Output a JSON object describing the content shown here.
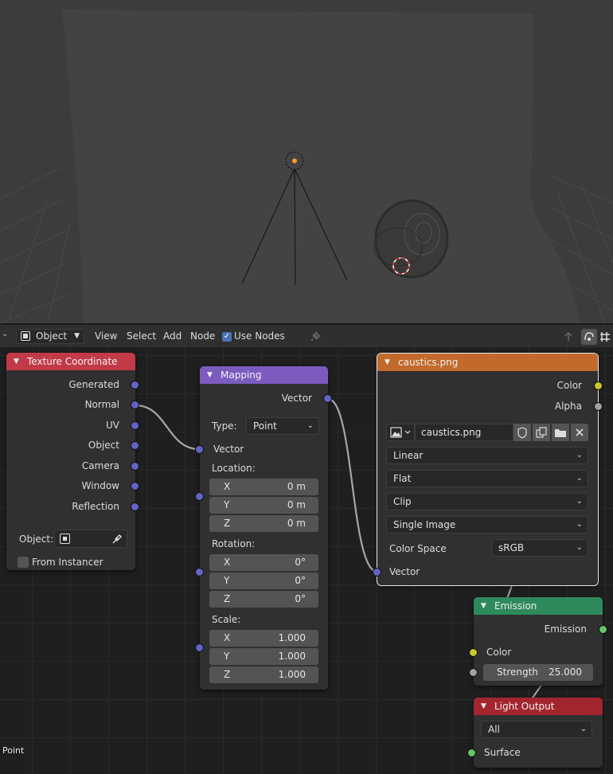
{
  "header": {
    "mode_label": "Object",
    "menu": {
      "view": "View",
      "select": "Select",
      "add": "Add",
      "node": "Node"
    },
    "use_nodes_label": "Use Nodes",
    "use_nodes_checked": true
  },
  "status": {
    "mode_text": "Point"
  },
  "nodes": {
    "texture_coordinate": {
      "title": "Texture Coordinate",
      "outputs": [
        "Generated",
        "Normal",
        "UV",
        "Object",
        "Camera",
        "Window",
        "Reflection"
      ],
      "object_label": "Object:",
      "from_instancer_label": "From Instancer"
    },
    "mapping": {
      "title": "Mapping",
      "output": "Vector",
      "type_label": "Type:",
      "type_value": "Point",
      "vector_input": "Vector",
      "location_label": "Location:",
      "location": [
        {
          "axis": "X",
          "value": "0 m"
        },
        {
          "axis": "Y",
          "value": "0 m"
        },
        {
          "axis": "Z",
          "value": "0 m"
        }
      ],
      "rotation_label": "Rotation:",
      "rotation": [
        {
          "axis": "X",
          "value": "0°"
        },
        {
          "axis": "Y",
          "value": "0°"
        },
        {
          "axis": "Z",
          "value": "0°"
        }
      ],
      "scale_label": "Scale:",
      "scale": [
        {
          "axis": "X",
          "value": "1.000"
        },
        {
          "axis": "Y",
          "value": "1.000"
        },
        {
          "axis": "Z",
          "value": "1.000"
        }
      ]
    },
    "image_texture": {
      "title": "caustics.png",
      "outputs": {
        "color": "Color",
        "alpha": "Alpha"
      },
      "image_name": "caustics.png",
      "interpolation": "Linear",
      "projection": "Flat",
      "extension": "Clip",
      "source": "Single Image",
      "color_space_label": "Color Space",
      "color_space_value": "sRGB",
      "vector_input": "Vector"
    },
    "emission": {
      "title": "Emission",
      "output": "Emission",
      "color_input": "Color",
      "strength_label": "Strength",
      "strength_value": "25.000"
    },
    "light_output": {
      "title": "Light Output",
      "target": "All",
      "surface_input": "Surface"
    }
  },
  "colors": {
    "tex_coord_header": "#c23a47",
    "mapping_header": "#7c5bbf",
    "image_header": "#c26a2b",
    "emission_header": "#2e8a5b",
    "light_output_header": "#a3262f",
    "socket_vector": "#6363c7",
    "socket_color": "#c7c729",
    "socket_float": "#a1a1a1",
    "socket_shader": "#63c763"
  }
}
